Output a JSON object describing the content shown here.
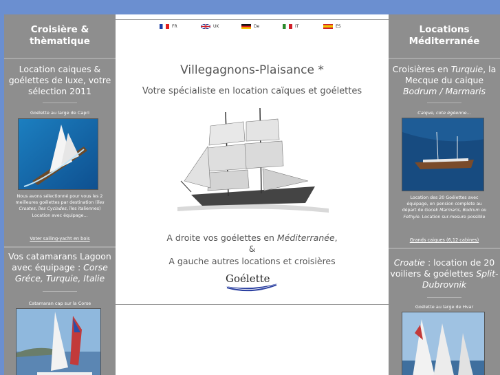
{
  "flags": [
    {
      "code": "FR",
      "colors": [
        "#1a3ea6",
        "#ffffff",
        "#e02020"
      ]
    },
    {
      "code": "UK",
      "colors": [
        "#1f3a93",
        "#ffffff",
        "#d0202a"
      ]
    },
    {
      "code": "De",
      "colors": [
        "#111111",
        "#d81e1e",
        "#f5c400"
      ]
    },
    {
      "code": "IT",
      "colors": [
        "#2a8a2a",
        "#ffffff",
        "#d0202a"
      ]
    },
    {
      "code": "ES",
      "colors": [
        "#d0202a",
        "#f3c400",
        "#d0202a"
      ]
    }
  ],
  "left": {
    "header": "Croisière & thèmatique",
    "section1": {
      "title": "Location caiques & goélettes de luxe, votre sélection 2011",
      "caption": "Goélette au large de Capri",
      "desc_pre": "Nous avons sélectionné pour vous les 2 meilleures goélettes par destination (",
      "desc_em": "îles Croates, îles Cyclades",
      "desc_post": ", îles italiennes) Location avec équipage...",
      "link": "Voter sailing-yacht en bois"
    },
    "section2": {
      "title_pre": "Vos catamarans Lagoon avec équipage : ",
      "title_em": "Corse Gréce, Turquie, Italie",
      "caption": "Catamaran cap sur la Corse"
    }
  },
  "center": {
    "site_title": "Villegagnons-Plaisance *",
    "subtitle": "Votre spécialiste en location caïques et goélettes",
    "line1_pre": "A droite vos goélettes en ",
    "line1_em": "Méditerranée",
    "line1_post": ",",
    "amp": "&",
    "line2": "A gauche autres locations et croisières",
    "logo_text": "Goélette"
  },
  "right": {
    "header": "Locations Méditerranée",
    "section1": {
      "title_pre": "Croisières en ",
      "title_em1": "Turquie",
      "title_mid": ", la Mecque du caique ",
      "title_em2": "Bodrum / Marmaris",
      "caption": "Caique, cote égéenne...",
      "desc_pre": "Location des 20 Goélettes avec équipage, en pension complete au départ de ",
      "desc_em": "Gocek Marmaris, Bodrum ou Fethyie",
      "desc_post": ". Location sur-mesure possible",
      "link": "Grands caiques (6,12 cabines)"
    },
    "section2": {
      "title_em1": "Croatie",
      "title_mid": " : location de 20 voiliers & goélettes ",
      "title_em2": "Split-Dubrovnik",
      "caption": "Goélette au large de Hvar"
    }
  }
}
